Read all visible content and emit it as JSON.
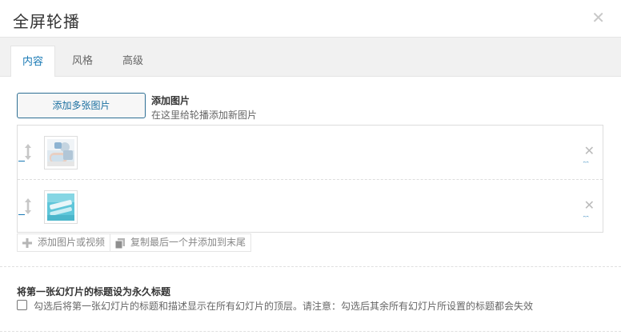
{
  "dialog": {
    "title": "全屏轮播"
  },
  "tabs": [
    {
      "label": "内容",
      "active": true
    },
    {
      "label": "风格",
      "active": false
    },
    {
      "label": "高级",
      "active": false
    }
  ],
  "add_images": {
    "button_label": "添加多张图片",
    "title": "添加图片",
    "description": "在这里给轮播添加新图片"
  },
  "slides": [
    {
      "thumbnail": "medical-photo",
      "icon": "image"
    },
    {
      "thumbnail": "tooth-brush-photo",
      "icon": "image"
    }
  ],
  "list_actions": {
    "add_label": "添加图片或视频",
    "duplicate_label": "复制最后一个并添加到末尾"
  },
  "permanent_title": {
    "title": "将第一张幻灯片的标题设为永久标题",
    "checkbox_label": "勾选后将第一张幻灯片的标题和描述显示在所有幻灯片的顶层。请注意：勾选后其余所有幻灯片所设置的标题都会失效",
    "checked": false
  },
  "colors": {
    "accent": "#1a7ab5",
    "tabbar_bg": "#f1f1f1",
    "border": "#dddddd"
  }
}
